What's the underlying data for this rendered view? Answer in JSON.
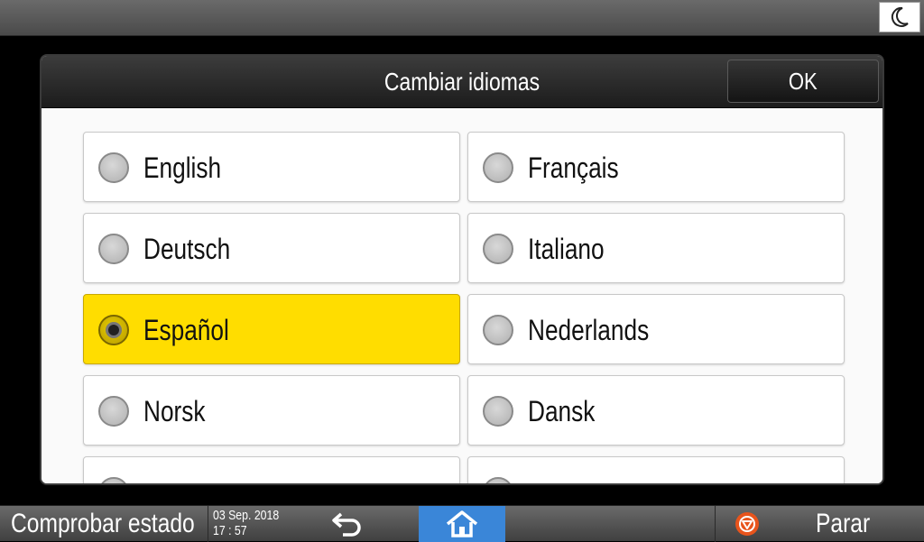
{
  "dialog": {
    "title": "Cambiar idiomas",
    "ok_label": "OK"
  },
  "languages": [
    {
      "label": "English",
      "selected": false
    },
    {
      "label": "Français",
      "selected": false
    },
    {
      "label": "Deutsch",
      "selected": false
    },
    {
      "label": "Italiano",
      "selected": false
    },
    {
      "label": "Español",
      "selected": true
    },
    {
      "label": "Nederlands",
      "selected": false
    },
    {
      "label": "Norsk",
      "selected": false
    },
    {
      "label": "Dansk",
      "selected": false
    },
    {
      "label": "",
      "selected": false
    },
    {
      "label": "",
      "selected": false
    }
  ],
  "bottom": {
    "status_label": "Comprobar estado",
    "date": "03 Sep. 2018",
    "time": "17 : 57",
    "stop_label": "Parar"
  },
  "icons": {
    "sleep": "moon-icon",
    "back": "back-arrow-icon",
    "home": "home-icon",
    "stop": "stop-icon"
  },
  "colors": {
    "selected_bg": "#ffdd00",
    "home_bg": "#3a86d8",
    "stop_icon": "#e8541c"
  }
}
